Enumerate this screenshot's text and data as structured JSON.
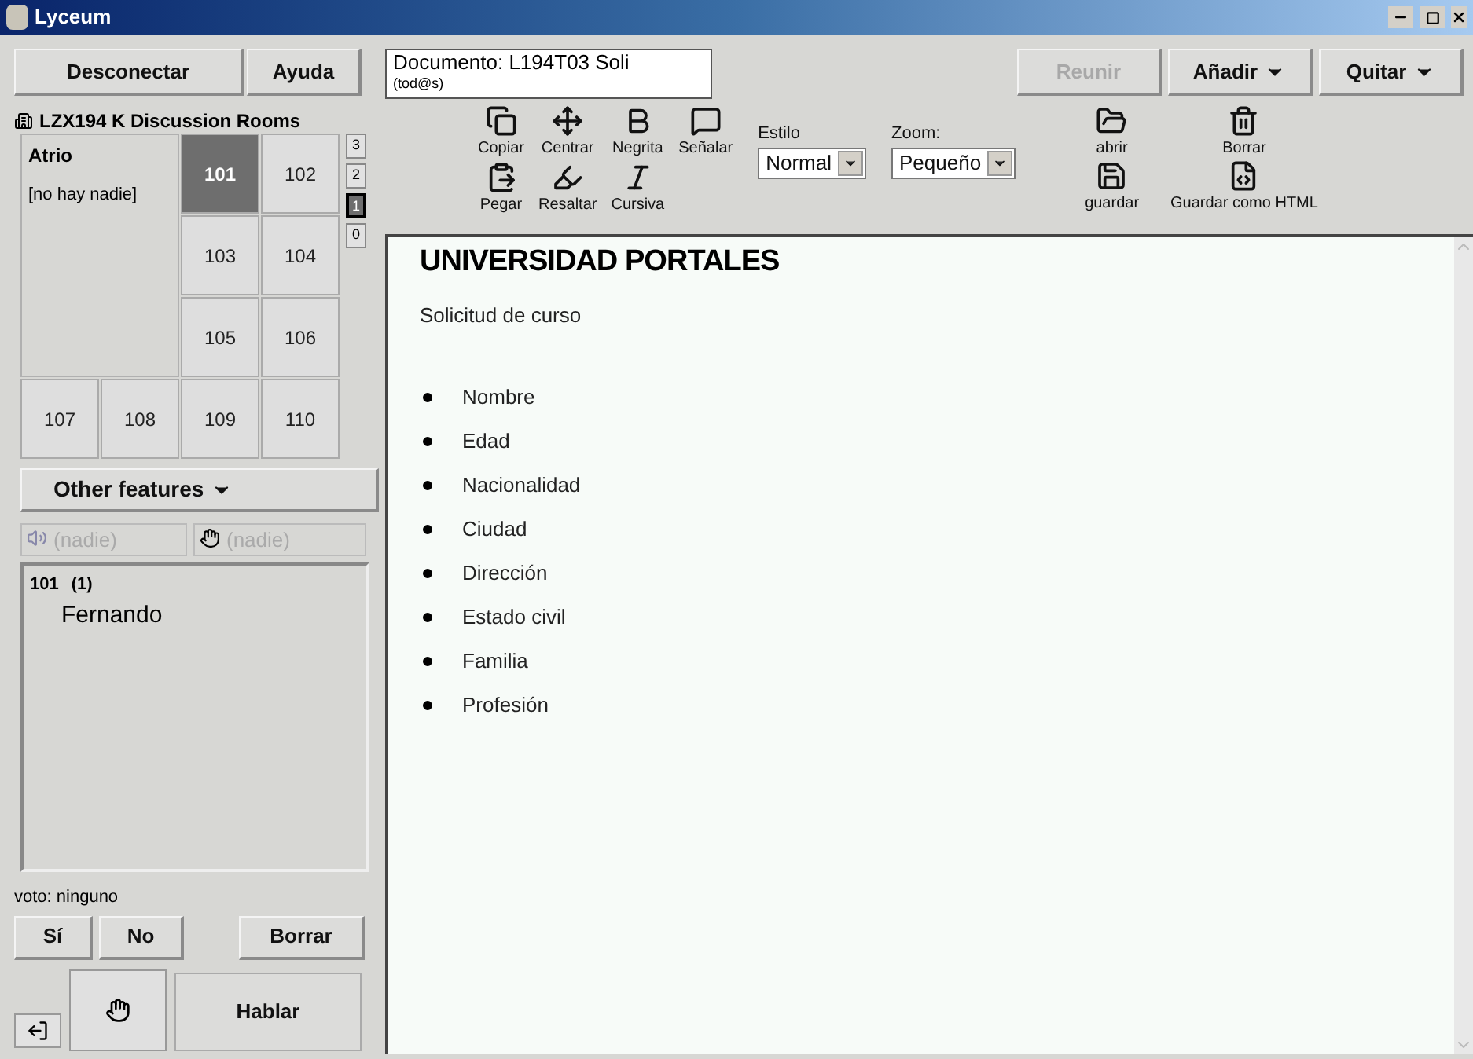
{
  "window": {
    "title": "Lyceum"
  },
  "top_buttons": [
    {
      "label": "Desconectar",
      "disabled": false
    },
    {
      "label": "Ayuda",
      "disabled": false
    }
  ],
  "document_field": {
    "title": "Documento: L194T03 Soli",
    "subtitle": "(tod@s)"
  },
  "right_buttons": [
    {
      "label": "Reunir",
      "disabled": true,
      "dropdown": false
    },
    {
      "label": "Añadir",
      "disabled": false,
      "dropdown": true
    },
    {
      "label": "Quitar",
      "disabled": false,
      "dropdown": true
    }
  ],
  "rooms": {
    "title": "LZX194 K Discussion Rooms",
    "atrio": {
      "name": "Atrio",
      "occupants": "[no hay nadie]"
    },
    "items": [
      {
        "label": "101",
        "selected": true
      },
      {
        "label": "102",
        "selected": false
      },
      {
        "label": "103",
        "selected": false
      },
      {
        "label": "104",
        "selected": false
      },
      {
        "label": "105",
        "selected": false
      },
      {
        "label": "106",
        "selected": false
      },
      {
        "label": "107",
        "selected": false
      },
      {
        "label": "108",
        "selected": false
      },
      {
        "label": "109",
        "selected": false
      },
      {
        "label": "110",
        "selected": false
      }
    ],
    "floors": [
      {
        "label": "3",
        "selected": false
      },
      {
        "label": "2",
        "selected": false
      },
      {
        "label": "1",
        "selected": true
      },
      {
        "label": "0",
        "selected": false
      }
    ]
  },
  "other_features": "Other features",
  "speaker_field": {
    "placeholder": "(nadie)"
  },
  "hand_field": {
    "placeholder": "(nadie)"
  },
  "participants": {
    "room": "101",
    "count": "(1)",
    "names": [
      "Fernando"
    ]
  },
  "vote": "voto: ninguno",
  "vote_buttons": [
    "Sí",
    "No",
    "Borrar"
  ],
  "speak_button": "Hablar",
  "toolbar": {
    "tools": [
      {
        "kind": "copy",
        "label": "Copiar"
      },
      {
        "kind": "center",
        "label": "Centrar"
      },
      {
        "kind": "bold",
        "label": "Negrita"
      },
      {
        "kind": "point",
        "label": "Señalar"
      },
      {
        "kind": "paste",
        "label": "Pegar"
      },
      {
        "kind": "highlight",
        "label": "Resaltar"
      },
      {
        "kind": "italic",
        "label": "Cursiva"
      }
    ],
    "style": {
      "label": "Estilo",
      "value": "Normal"
    },
    "zoom": {
      "label": "Zoom:",
      "value": "Pequeño"
    },
    "file_tools": [
      {
        "kind": "open",
        "label": "abrir"
      },
      {
        "kind": "delete",
        "label": "Borrar"
      },
      {
        "kind": "save",
        "label": "guardar"
      },
      {
        "kind": "html",
        "label": "Guardar como HTML"
      }
    ]
  },
  "document": {
    "heading": "UNIVERSIDAD PORTALES",
    "subtitle": "Solicitud de curso",
    "items": [
      "Nombre",
      "Edad",
      "Nacionalidad",
      "Ciudad",
      "Dirección",
      "Estado civil",
      "Familia",
      "Profesión"
    ]
  }
}
